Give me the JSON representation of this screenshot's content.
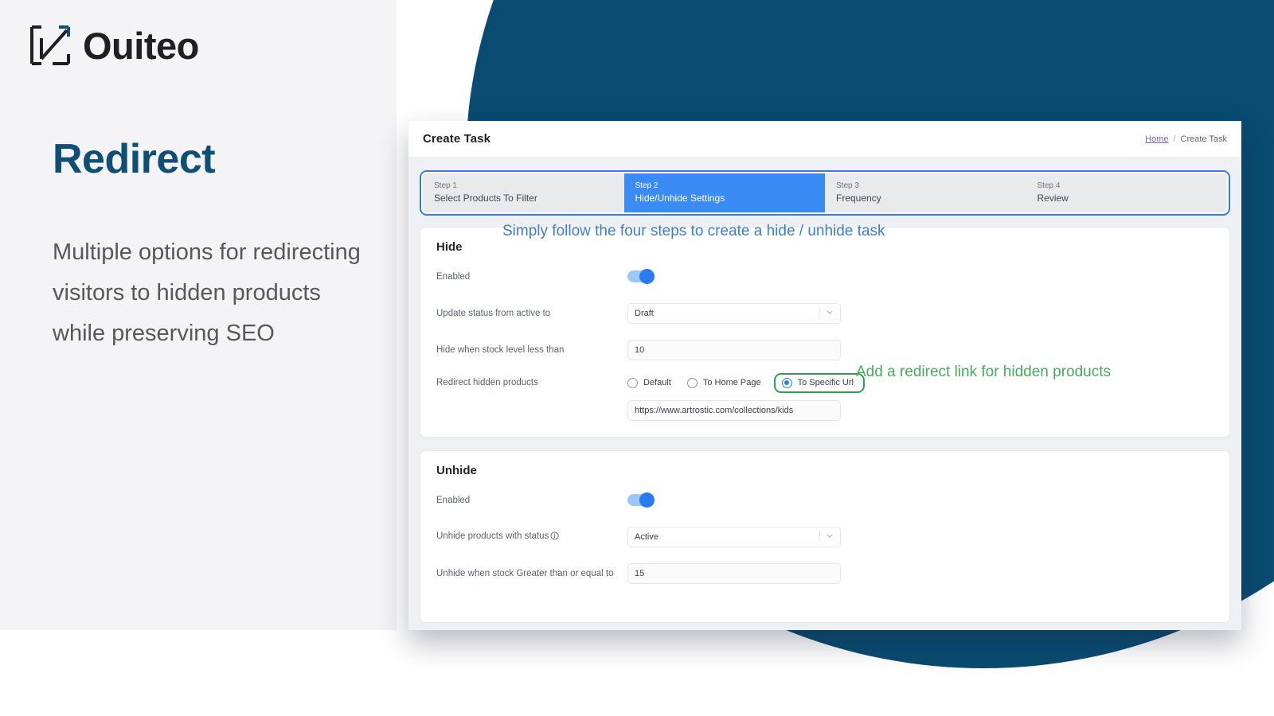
{
  "brand": {
    "logo_icon": "bracket-arrow-icon",
    "name": "Ouiteo"
  },
  "promo": {
    "headline": "Redirect",
    "body": "Multiple options for redirecting visitors to hidden products while preserving SEO",
    "clipped_line": "."
  },
  "annotations": {
    "blue": "Simply follow the four steps to create a hide / unhide task",
    "green": "Add a redirect link for hidden products"
  },
  "app": {
    "title": "Create Task",
    "breadcrumb": {
      "home": "Home",
      "separator": "/",
      "current": "Create Task"
    },
    "stepper": [
      {
        "num": "Step 1",
        "label": "Select Products To Filter",
        "active": false
      },
      {
        "num": "Step 2",
        "label": "Hide/Unhide Settings",
        "active": true
      },
      {
        "num": "Step 3",
        "label": "Frequency",
        "active": false
      },
      {
        "num": "Step 4",
        "label": "Review",
        "active": false
      }
    ],
    "hide": {
      "title": "Hide",
      "enabled_label": "Enabled",
      "enabled_value": "on",
      "status_label": "Update status from active to",
      "status_value": "Draft",
      "stock_label": "Hide when stock level less than",
      "stock_value": "10",
      "redirect_label": "Redirect hidden products",
      "radios": [
        {
          "label": "Default",
          "selected": false
        },
        {
          "label": "To Home Page",
          "selected": false
        },
        {
          "label": "To Specific Url",
          "selected": true
        }
      ],
      "url_value": "https://www.artrostic.com/collections/kids"
    },
    "unhide": {
      "title": "Unhide",
      "enabled_label": "Enabled",
      "enabled_value": "on",
      "status_label": "Unhide products with status",
      "status_value": "Active",
      "stock_label": "Unhide when stock Greater than or equal to",
      "stock_value": "15"
    }
  },
  "colors": {
    "navy": "#0a4b72",
    "heading_blue": "#0d4f77",
    "accent_blue": "#3b8bf5",
    "annotation_green": "#46aa5e",
    "annotation_blue": "#3d7dd1",
    "panel_gray": "#f4f3f6"
  }
}
